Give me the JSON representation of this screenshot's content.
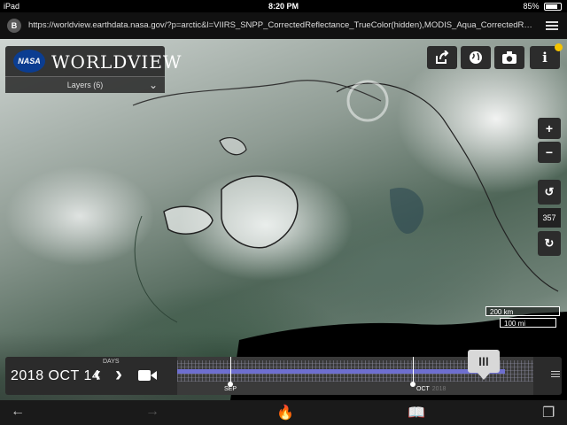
{
  "status_bar": {
    "device": "iPad",
    "time": "8:20 PM",
    "battery": "85%"
  },
  "browser": {
    "favicon_letter": "B",
    "url": "https://worldview.earthdata.nasa.gov/?p=arctic&l=VIIRS_SNPP_CorrectedReflectance_TrueColor(hidden),MODIS_Aqua_CorrectedReflectance_True..."
  },
  "app": {
    "logo_text": "WORLDVIEW",
    "nasa_label": "NASA",
    "layers_label": "Layers (6)",
    "tools": [
      "share-icon",
      "globe-icon",
      "camera-icon",
      "info-icon"
    ]
  },
  "map_controls": {
    "zoom_in": "+",
    "zoom_out": "−",
    "rotation": "357",
    "scale_km": "200 km",
    "scale_mi": "100 mi"
  },
  "timeline": {
    "date": "2018 OCT 14",
    "days_label": "DAYS",
    "months": [
      {
        "label": "SEP",
        "year": ""
      },
      {
        "label": "OCT",
        "year": "2018"
      }
    ],
    "handle_label": "III"
  },
  "bottom_bar": {
    "icons": [
      "back-icon",
      "forward-icon",
      "fire-icon",
      "book-icon",
      "tabs-icon"
    ]
  }
}
